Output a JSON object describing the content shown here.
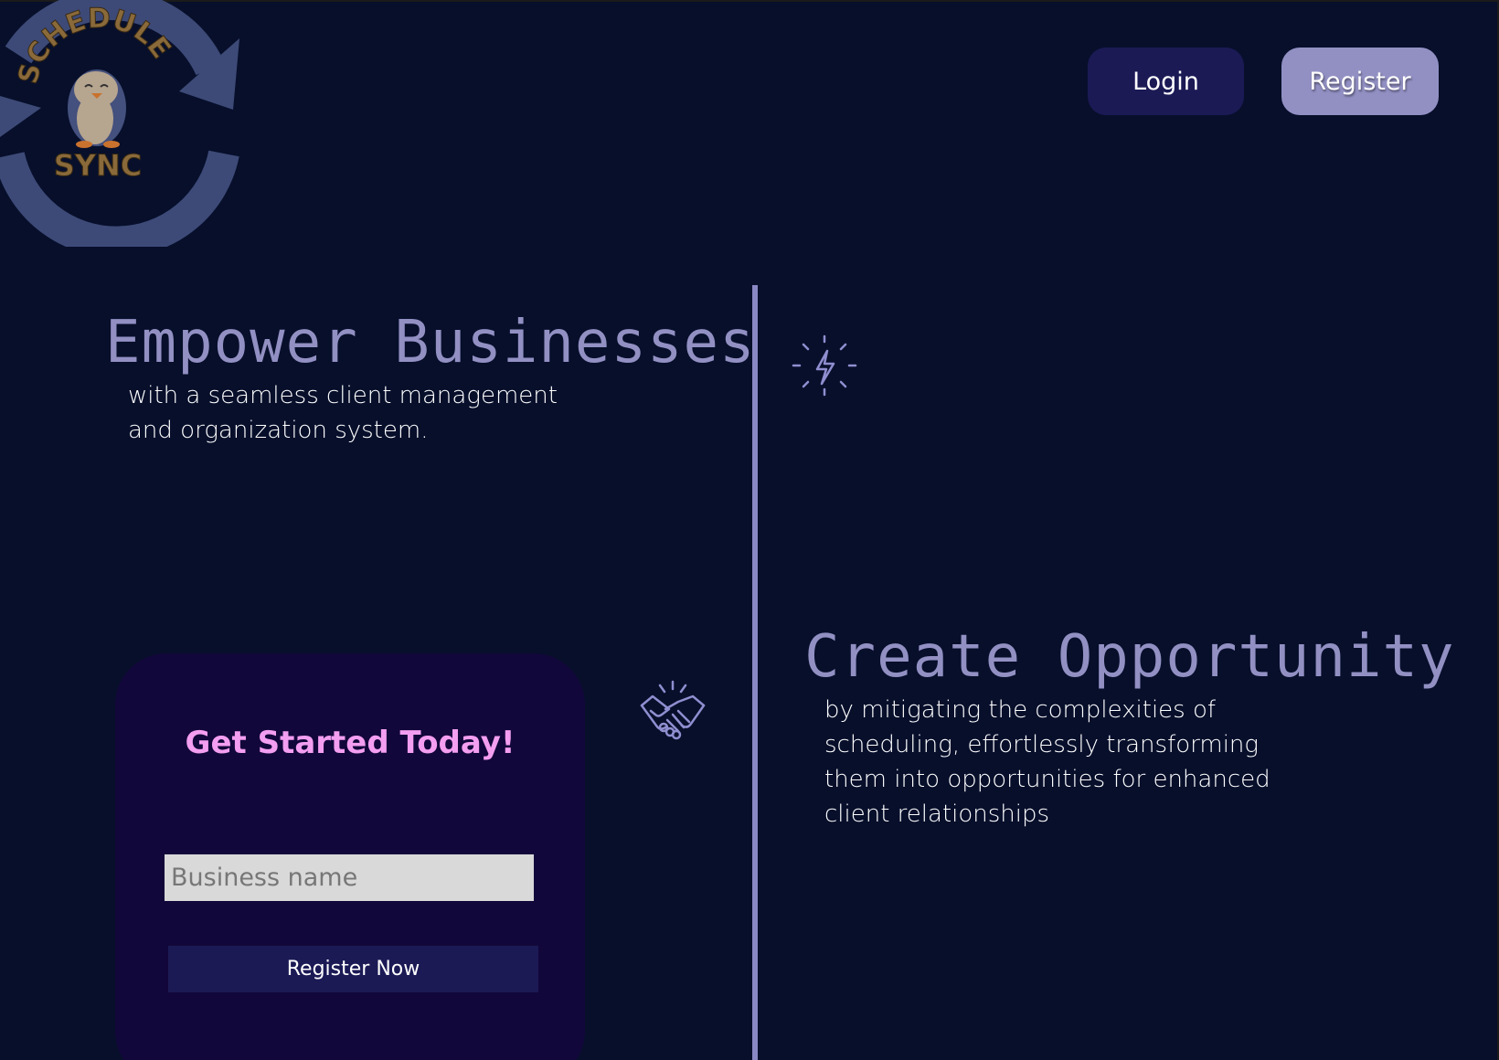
{
  "logo": {
    "top_text": "SCHEDULE",
    "bottom_text": "SYNC"
  },
  "header": {
    "login_label": "Login",
    "register_label": "Register"
  },
  "hero": {
    "heading": "Empower Businesses",
    "lines": [
      "with a seamless client management",
      "and organization system."
    ]
  },
  "opportunity": {
    "heading": "Create Opportunity",
    "lines": [
      "by mitigating the complexities of",
      "scheduling, effortlessly transforming",
      "them into opportunities for enhanced",
      "client relationships"
    ]
  },
  "signup": {
    "title": "Get Started Today!",
    "business_placeholder": "Business name",
    "submit_label": "Register Now"
  },
  "icons": {
    "hero": "lightning-bolt-icon",
    "signup": "handshake-icon"
  },
  "colors": {
    "background": "#070f2b",
    "accent": "#9290c3",
    "button_dark": "#1b1a55",
    "card": "#12073a",
    "card_title": "#f39ef1"
  }
}
